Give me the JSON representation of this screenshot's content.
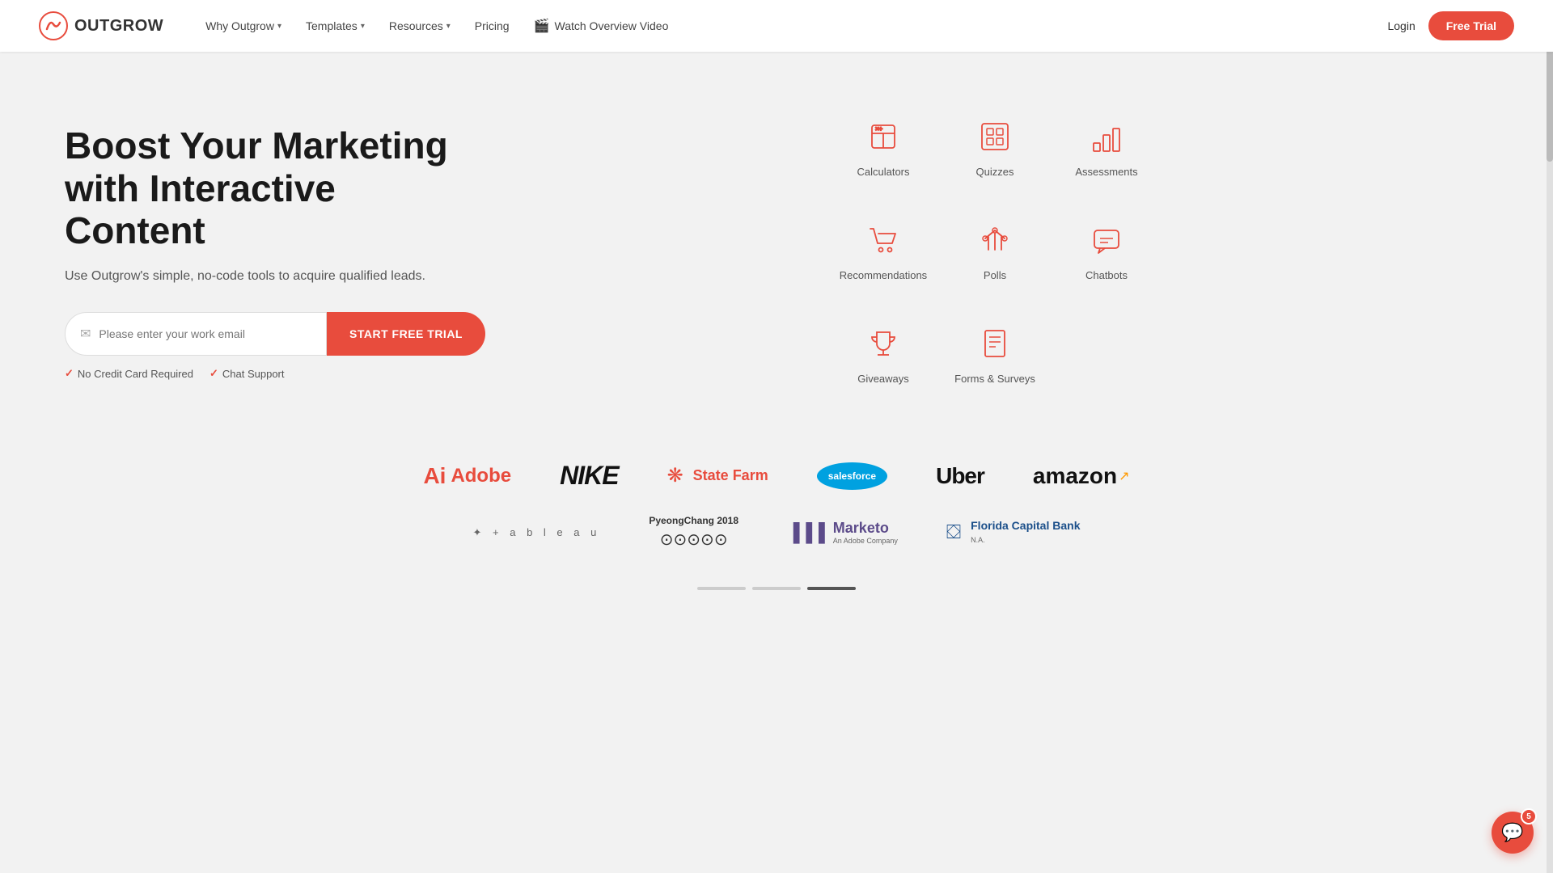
{
  "nav": {
    "logo_text": "OUTGROW",
    "links": [
      {
        "label": "Why Outgrow",
        "has_dropdown": true
      },
      {
        "label": "Templates",
        "has_dropdown": true
      },
      {
        "label": "Resources",
        "has_dropdown": true
      }
    ],
    "pricing_label": "Pricing",
    "video_label": "Watch Overview Video",
    "login_label": "Login",
    "trial_label": "Free Trial"
  },
  "hero": {
    "title": "Boost Your Marketing with Interactive Content",
    "subtitle": "Use Outgrow's simple, no-code tools to acquire qualified leads.",
    "email_placeholder": "Please enter your work email",
    "cta_label": "START FREE TRIAL",
    "checks": [
      {
        "label": "No Credit Card Required"
      },
      {
        "label": "Chat Support"
      }
    ]
  },
  "content_types": [
    {
      "label": "Calculators",
      "icon": "calculator"
    },
    {
      "label": "Quizzes",
      "icon": "quiz"
    },
    {
      "label": "Assessments",
      "icon": "assessment"
    },
    {
      "label": "Recommendations",
      "icon": "cart"
    },
    {
      "label": "Polls",
      "icon": "poll"
    },
    {
      "label": "Chatbots",
      "icon": "chatbot"
    },
    {
      "label": "Giveaways",
      "icon": "trophy"
    },
    {
      "label": "Forms & Surveys",
      "icon": "forms"
    }
  ],
  "brands": {
    "row1": [
      "Adobe",
      "Nike",
      "State Farm",
      "Salesforce",
      "Uber",
      "amazon"
    ],
    "row2": [
      "Tableau",
      "PyeongChang 2018",
      "Marketo",
      "Florida Capital Bank"
    ]
  },
  "chat": {
    "badge": "5"
  },
  "scroll_indicator": {
    "dots": [
      "inactive",
      "inactive",
      "active"
    ]
  }
}
